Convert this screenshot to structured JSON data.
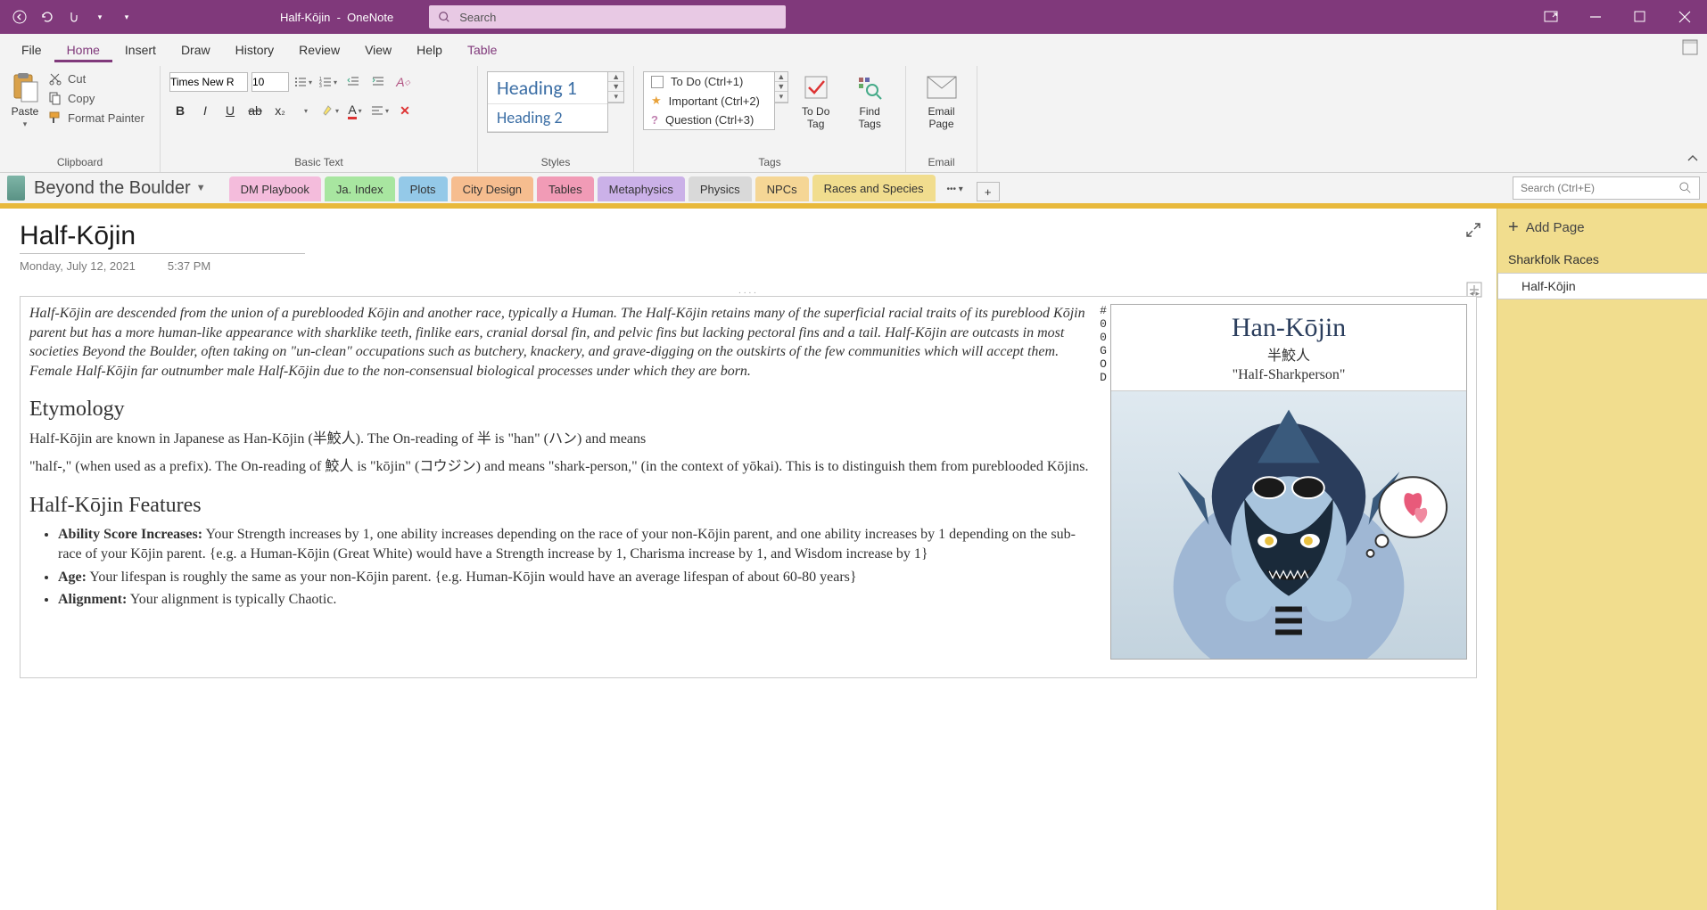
{
  "app": {
    "title_doc": "Half-Kōjin",
    "title_app": "OneNote",
    "search_placeholder": "Search"
  },
  "menu": {
    "file": "File",
    "home": "Home",
    "insert": "Insert",
    "draw": "Draw",
    "history": "History",
    "review": "Review",
    "view": "View",
    "help": "Help",
    "table": "Table"
  },
  "ribbon": {
    "paste": "Paste",
    "cut": "Cut",
    "copy": "Copy",
    "format_painter": "Format Painter",
    "clipboard": "Clipboard",
    "font_name": "Times New R",
    "font_size": "10",
    "basic_text": "Basic Text",
    "heading1": "Heading 1",
    "heading2": "Heading 2",
    "styles": "Styles",
    "todo_tag": "To Do (Ctrl+1)",
    "important_tag": "Important (Ctrl+2)",
    "question_tag": "Question (Ctrl+3)",
    "tags": "Tags",
    "todo_btn": "To Do Tag",
    "find_tags": "Find Tags",
    "email_page": "Email Page",
    "email": "Email"
  },
  "notebook": {
    "name": "Beyond the Boulder",
    "sections": {
      "dm": "DM Playbook",
      "ja": "Ja. Index",
      "plots": "Plots",
      "city": "City Design",
      "tables": "Tables",
      "meta": "Metaphysics",
      "physics": "Physics",
      "npcs": "NPCs",
      "races": "Races and Species"
    },
    "search_placeholder": "Search (Ctrl+E)"
  },
  "page": {
    "title": "Half-Kōjin",
    "date": "Monday, July 12, 2021",
    "time": "5:37 PM"
  },
  "content": {
    "lead": "Half-Kōjin are descended from the union of a pureblooded Kōjin and another race, typically a Human. The Half-Kōjin retains many of the superficial racial traits of its pureblood Kōjin parent but has a more human-like appearance with sharklike teeth, finlike ears, cranial dorsal fin, and pelvic fins but lacking pectoral fins and a tail. Half-Kōjin are outcasts in most societies Beyond the Boulder, often taking on \"un-clean\" occupations such as butchery, knackery, and grave-digging on the outskirts of the few communities which will accept them. Female Half-Kōjin far outnumber male Half-Kōjin due to the non-consensual biological processes under which they are born.",
    "etymology_h": "Etymology",
    "etymology_p1": "Half-Kōjin are known in Japanese as Han-Kōjin (半鮫人). The On-reading of 半 is \"han\" (ハン) and means",
    "etymology_p2": "\"half-,\" (when used as a prefix). The On-reading of 鮫人 is \"kōjin\" (コウジン) and means \"shark-person,\" (in the context of yōkai). This is to distinguish them from pureblooded Kōjins.",
    "features_h": "Half-Kōjin Features",
    "feature_ability_label": "Ability Score Increases:",
    "feature_ability": " Your Strength increases by 1, one ability increases depending on the race of your non-Kōjin parent, and one ability increases by 1 depending on the sub-race of your Kōjin parent. {e.g. a Human-Kōjin (Great White) would have a Strength increase by 1, Charisma increase by 1, and Wisdom increase by 1}",
    "feature_age_label": "Age:",
    "feature_age": " Your lifespan is roughly the same as your non-Kōjin parent. {e.g. Human-Kōjin would have an average lifespan of about 60-80 years}",
    "feature_align_label": "Alignment:",
    "feature_align": " Your alignment is typically Chaotic.",
    "card_title": "Han-Kōjin",
    "card_jp": "半鮫人",
    "card_sub": "\"Half-Sharkperson\"",
    "hash_chars": [
      "#",
      "0",
      "0",
      "G",
      "O",
      "D"
    ]
  },
  "page_list": {
    "add": "Add Page",
    "parent": "Sharkfolk Races",
    "child": "Half-Kōjin"
  }
}
